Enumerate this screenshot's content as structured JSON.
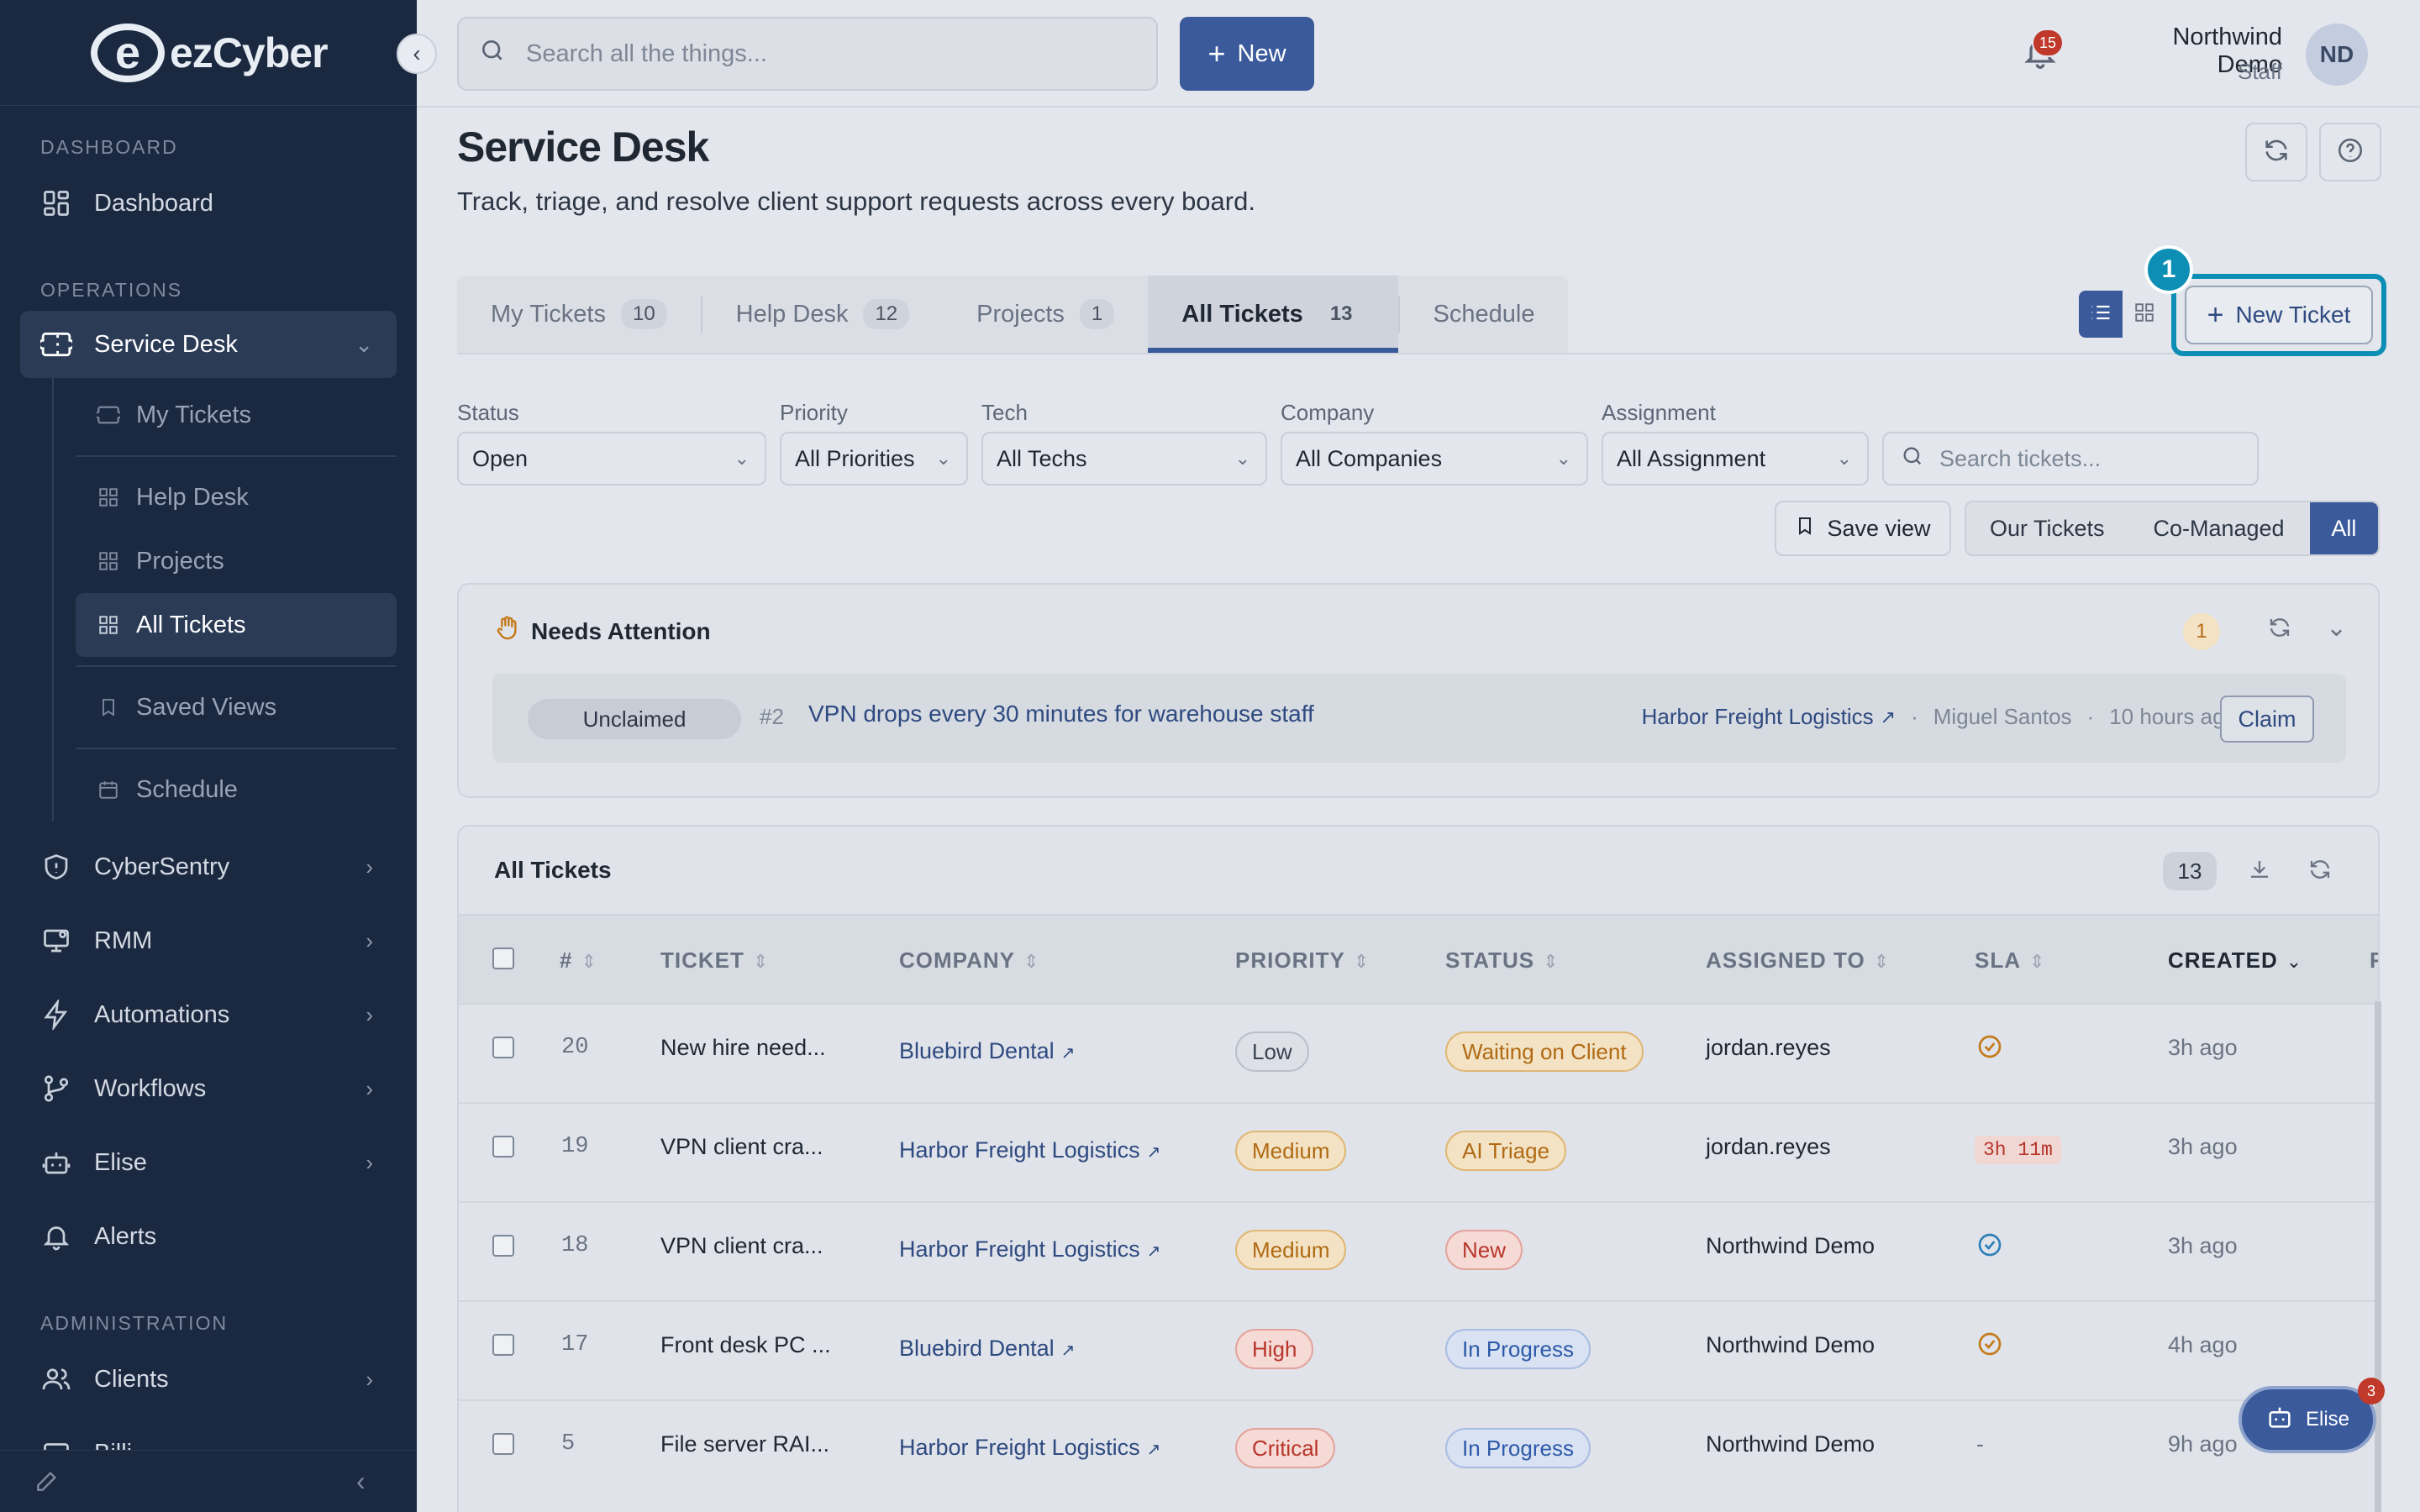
{
  "brand": {
    "logo_letter": "e",
    "name": "ezCyber"
  },
  "sidebar": {
    "sections": {
      "dashboard": "DASHBOARD",
      "operations": "OPERATIONS",
      "administration": "ADMINISTRATION"
    },
    "dashboard": "Dashboard",
    "service_desk": "Service Desk",
    "sub_items": [
      "My Tickets",
      "Help Desk",
      "Projects",
      "All Tickets",
      "Saved Views",
      "Schedule"
    ],
    "cybersentry": "CyberSentry",
    "rmm": "RMM",
    "automations": "Automations",
    "workflows": "Workflows",
    "elise": "Elise",
    "alerts": "Alerts",
    "clients": "Clients",
    "billing_partial": "Billi"
  },
  "topbar": {
    "search_placeholder": "Search all the things...",
    "new_label": "New",
    "notif_count": "15",
    "user_name": "Northwind Demo",
    "user_role": "Staff",
    "avatar_initials": "ND"
  },
  "page": {
    "title": "Service Desk",
    "subtitle": "Track, triage, and resolve client support requests across every board."
  },
  "tabs": [
    {
      "label": "My Tickets",
      "count": "10"
    },
    {
      "label": "Help Desk",
      "count": "12"
    },
    {
      "label": "Projects",
      "count": "1"
    },
    {
      "label": "All Tickets",
      "count": "13"
    },
    {
      "label": "Schedule",
      "count": ""
    }
  ],
  "new_ticket": {
    "label": "New Ticket",
    "step_badge": "1"
  },
  "filters": {
    "status": {
      "label": "Status",
      "value": "Open"
    },
    "priority": {
      "label": "Priority",
      "value": "All Priorities"
    },
    "tech": {
      "label": "Tech",
      "value": "All Techs"
    },
    "company": {
      "label": "Company",
      "value": "All Companies"
    },
    "assignment": {
      "label": "Assignment",
      "value": "All Assignment"
    },
    "search_placeholder": "Search tickets...",
    "save_view": "Save view",
    "scope": [
      "Our Tickets",
      "Co-Managed",
      "All"
    ]
  },
  "needs_attention": {
    "title": "Needs Attention",
    "count": "1",
    "item": {
      "state": "Unclaimed",
      "number": "#2",
      "title": "VPN drops every 30 minutes for warehouse staff",
      "company": "Harbor Freight Logistics",
      "sep": "·",
      "person": "Miguel Santos",
      "time": "10 hours ago",
      "action": "Claim"
    }
  },
  "all_tickets": {
    "title": "All Tickets",
    "count": "13",
    "columns": [
      "#",
      "TICKET",
      "COMPANY",
      "PRIORITY",
      "STATUS",
      "ASSIGNED TO",
      "SLA",
      "CREATED",
      "R"
    ],
    "rows": [
      {
        "num": "20",
        "ticket": "New hire need...",
        "company": "Bluebird Dental",
        "priority": "Low",
        "status": "Waiting on Client",
        "assigned": "jordan.reyes",
        "sla": "",
        "created": "3h ago"
      },
      {
        "num": "19",
        "ticket": "VPN client cra...",
        "company": "Harbor Freight Logistics",
        "priority": "Medium",
        "status": "AI Triage",
        "assigned": "jordan.reyes",
        "sla": "3h 11m",
        "created": "3h ago"
      },
      {
        "num": "18",
        "ticket": "VPN client cra...",
        "company": "Harbor Freight Logistics",
        "priority": "Medium",
        "status": "New",
        "assigned": "Northwind Demo",
        "sla": "",
        "created": "3h ago"
      },
      {
        "num": "17",
        "ticket": "Front desk PC ...",
        "company": "Bluebird Dental",
        "priority": "High",
        "status": "In Progress",
        "assigned": "Northwind Demo",
        "sla": "",
        "created": "4h ago"
      },
      {
        "num": "5",
        "ticket": "File server RAI...",
        "company": "Harbor Freight Logistics",
        "priority": "Critical",
        "status": "In Progress",
        "assigned": "Northwind Demo",
        "sla": "-",
        "created": "9h ago"
      }
    ]
  },
  "elise_chat": {
    "label": "Elise",
    "badge": "3"
  }
}
